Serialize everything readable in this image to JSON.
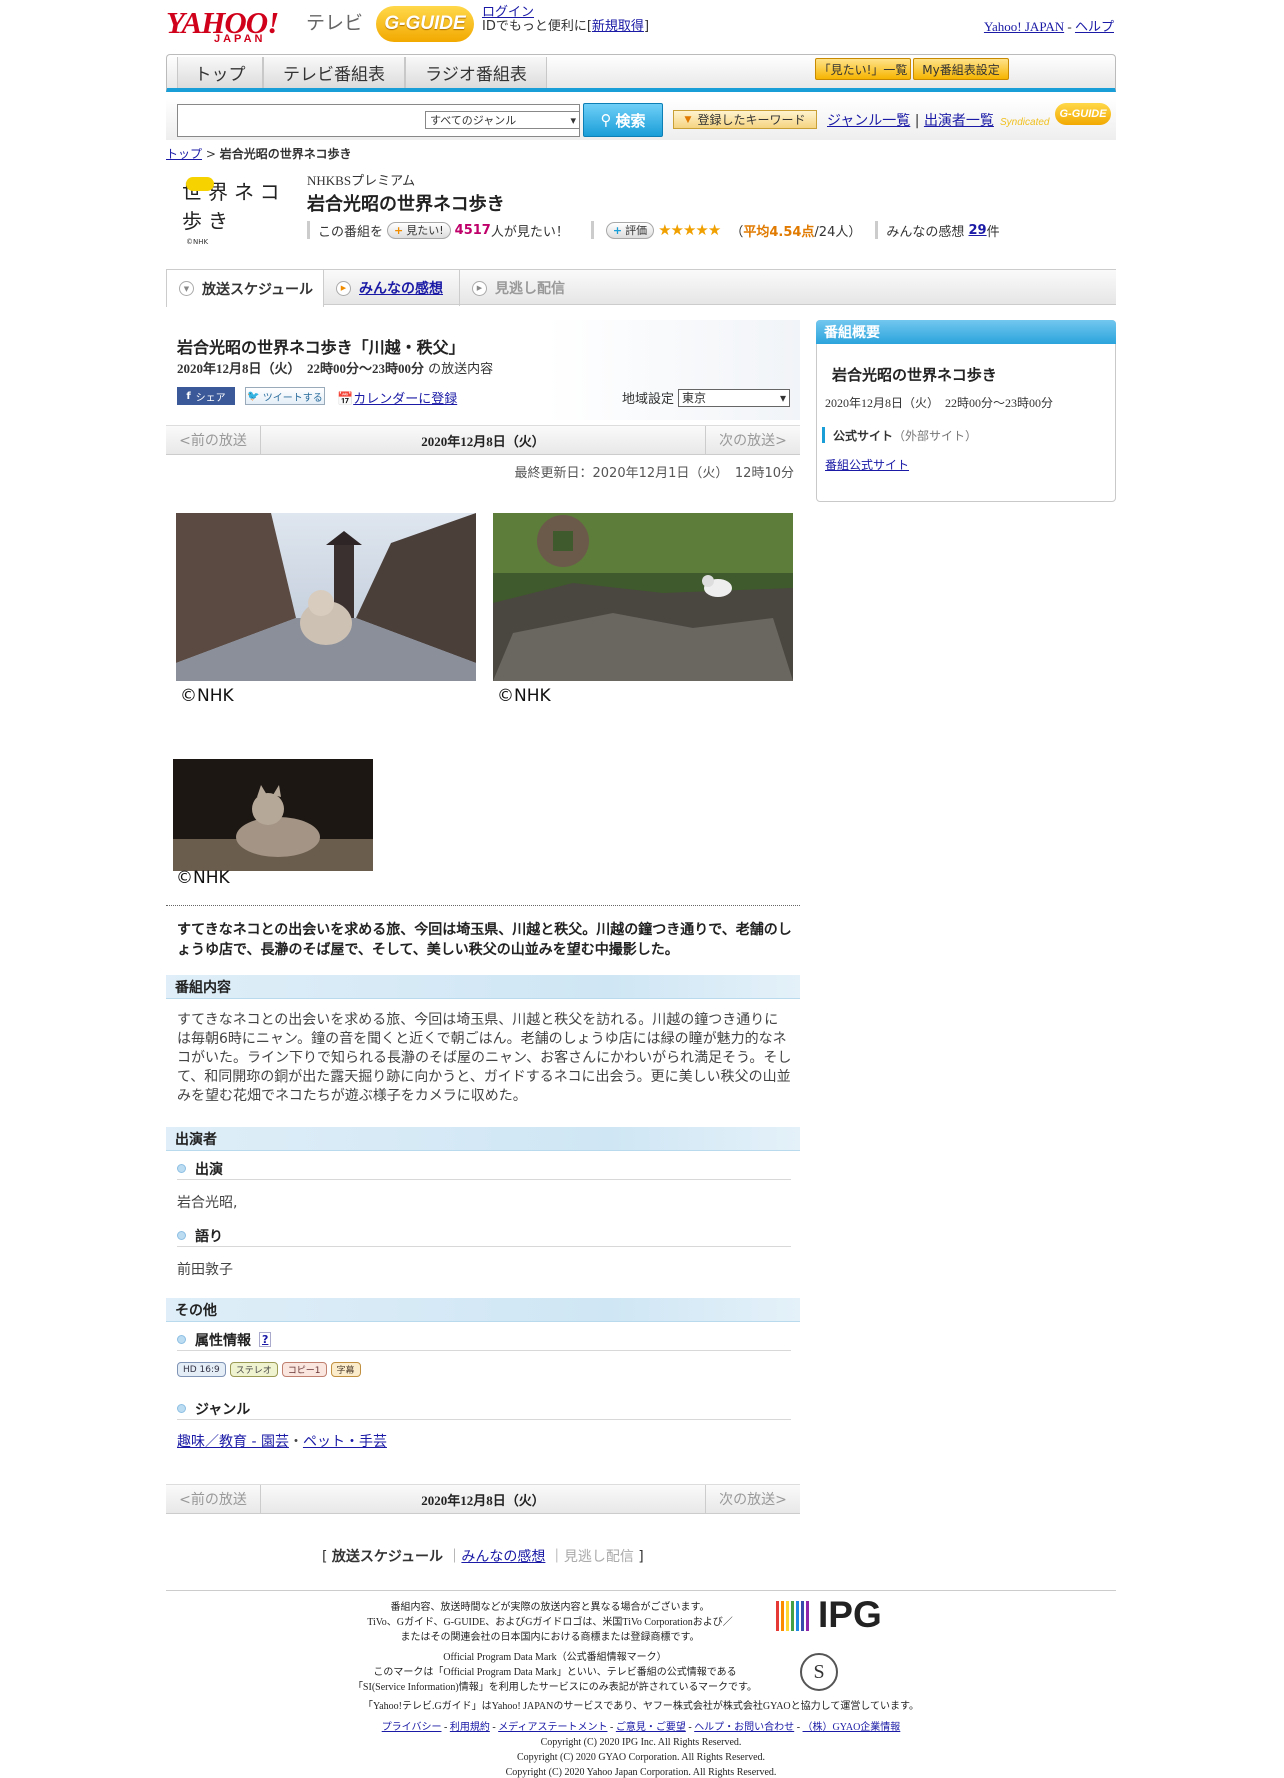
{
  "header": {
    "yahoo_logo": "YAHOO!",
    "yahoo_logo_sub": "JAPAN",
    "tv_label": "テレビ",
    "gguide_logo": "G-GUIDE",
    "login": "ログイン",
    "login_sub_prefix": "IDでもっと便利に[",
    "register": "新規取得",
    "login_sub_suffix": "]",
    "yahoo_japan": "Yahoo! JAPAN",
    "sep": " - ",
    "help": "ヘルプ"
  },
  "nav": {
    "tabs": [
      "トップ",
      "テレビ番組表",
      "ラジオ番組表"
    ],
    "btn_want": "「見たい!」一覧",
    "btn_my": "My番組表設定"
  },
  "search": {
    "placeholder": "",
    "genre": "すべてのジャンル",
    "button": "検索",
    "keyword_btn": "登録したキーワード",
    "genre_list": "ジャンル一覧",
    "pipe": "|",
    "performer_list": "出演者一覧",
    "syndicated": "Syndicated",
    "gguide_small": "G-GUIDE"
  },
  "breadcrumb": {
    "top": "トップ",
    "sep": " > ",
    "current": "岩合光昭の世界ネコ歩き"
  },
  "program": {
    "logo_text": "世界ネコ歩き",
    "logo_copy": "©NHK",
    "channel": "NHKBSプレミアム",
    "title": "岩合光昭の世界ネコ歩き",
    "want_prefix": "この番組を",
    "want_btn": "見たい!",
    "want_count": "4517",
    "want_suffix": "人が見たい！",
    "rate_btn": "評価",
    "stars": "★★★★★",
    "avg_open": "（",
    "avg": "平均4.54点",
    "avg_people": "/24人）",
    "reviews_prefix": "みんなの感想",
    "reviews_count": "29",
    "reviews_suffix": "件"
  },
  "tabs": {
    "schedule": "放送スケジュール",
    "reviews": "みんなの感想",
    "vod": "見逃し配信"
  },
  "episode": {
    "title": "岩合光昭の世界ネコ歩き「川越・秩父」",
    "datetime": "2020年12月8日（火）　22時00分～23時00分",
    "datetime_suffix": "の放送内容",
    "share": "シェア",
    "tweet": "ツイートする",
    "calendar": "カレンダーに登録",
    "region_label": "地域設定",
    "region": "東京",
    "prev": "<前の放送",
    "current_date": "2020年12月8日（火）",
    "next": "次の放送>",
    "updated": "最終更新日：2020年12月1日（火）　12時10分",
    "photo_credit": "©NHK",
    "lead": "すてきなネコとの出会いを求める旅、今回は埼玉県、川越と秩父。川越の鐘つき通りで、老舗のしょうゆ店で、長瀞のそば屋で、そして、美しい秩父の山並みを望む中撮影した。",
    "content_head": "番組内容",
    "content": "すてきなネコとの出会いを求める旅、今回は埼玉県、川越と秩父を訪れる。川越の鐘つき通りには毎朝6時にニャン。鐘の音を聞くと近くで朝ごはん。老舗のしょうゆ店には緑の瞳が魅力的なネコがいた。ライン下りで知られる長瀞のそば屋のニャン、お客さんにかわいがられ満足そう。そして、和同開珎の銅が出た露天掘り跡に向かうと、ガイドするネコに出会う。更に美しい秩父の山並みを望む花畑でネコたちが遊ぶ様子をカメラに収めた。",
    "cast_head": "出演者",
    "cast_sub": "出演",
    "cast": "岩合光昭,",
    "narr_sub": "語り",
    "narr": "前田敦子",
    "other_head": "その他",
    "attr_sub": "属性情報",
    "attr_help": "?",
    "badges": [
      "HD 16:9",
      "ステレオ",
      "コピー1",
      "字幕"
    ],
    "genre_sub": "ジャンル",
    "genre_link1": "趣味／教育 - 園芸",
    "genre_dot": "・",
    "genre_link2": "ペット・手芸"
  },
  "footer_tabs": {
    "open": "[ ",
    "schedule": "放送スケジュール",
    "sep": "｜",
    "reviews": "みんなの感想",
    "vod": "見逃し配信",
    "close": " ]"
  },
  "side": {
    "head": "番組概要",
    "title": "岩合光昭の世界ネコ歩き",
    "datetime": "2020年12月8日（火）　22時00分～23時00分",
    "site_label": "公式サイト",
    "site_note": "（外部サイト）",
    "site_link": "番組公式サイト"
  },
  "footer": {
    "l1": "番組内容、放送時間などが実際の放送内容と異なる場合がございます。",
    "l2": "TiVo、Gガイド、G-GUIDE、およびGガイドロゴは、米国TiVo Corporationおよび／",
    "l3": "またはその関連会社の日本国内における商標または登録商標です。",
    "ipg": "IPG",
    "l4": "Official Program Data Mark（公式番組情報マーク）",
    "l5": "このマークは「Official Program Data Mark」といい、テレビ番組の公式情報である",
    "l6": "「SI(Service Information)情報」を利用したサービスにのみ表記が許されているマークです。",
    "smark": "S",
    "l7": "「Yahoo!テレビ.Gガイド」はYahoo! JAPANのサービスであり、ヤフー株式会社が株式会社GYAOと協力して運営しています。",
    "links": [
      "プライバシー",
      "利用規約",
      "メディアステートメント",
      "ご意見・ご要望",
      "ヘルプ・お問い合わせ",
      "（株）GYAO企業情報"
    ],
    "c1": "Copyright (C) 2020 IPG Inc. All Rights Reserved.",
    "c2": "Copyright (C) 2020 GYAO Corporation. All Rights Reserved.",
    "c3": "Copyright (C) 2020 Yahoo Japan Corporation. All Rights Reserved."
  },
  "colors": {
    "accent": "#1a9ed8",
    "brand": "#d0021b",
    "gold": "#f2a900"
  }
}
